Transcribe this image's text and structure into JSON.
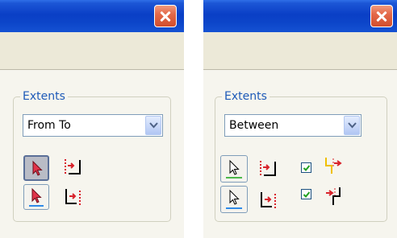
{
  "left_panel": {
    "group_label": "Extents",
    "extents_value": "From To"
  },
  "right_panel": {
    "group_label": "Extents",
    "extents_value": "Between",
    "checkbox_1_checked": true,
    "checkbox_2_checked": true
  },
  "colors": {
    "accent_text": "#1e5ab8",
    "titlebar_blue": "#0a3fc6",
    "close_red": "#d24e2c"
  }
}
